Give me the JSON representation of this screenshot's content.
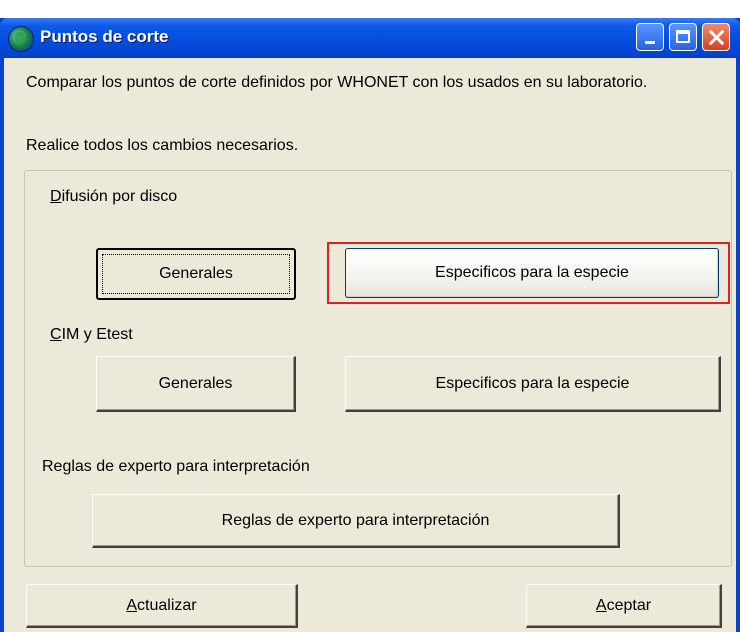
{
  "window": {
    "title": "Puntos de corte"
  },
  "texts": {
    "line1": "Comparar los puntos de corte definidos por WHONET con los usados en su laboratorio.",
    "line2": "Realice todos los cambios necesarios."
  },
  "disk": {
    "label_first": "D",
    "label_rest": "ifusión por disco",
    "general_button": "Generales",
    "species_button": "Especificos para la especie"
  },
  "mic": {
    "label_first": "C",
    "label_rest": "IM y Etest",
    "general_button": "Generales",
    "species_button": "Especificos para la especie"
  },
  "expert": {
    "label": "Reglas de experto para interpretación",
    "button": "Reglas de experto para interpretación"
  },
  "footer": {
    "update_first": "A",
    "update_rest": "ctualizar",
    "accept_first": "A",
    "accept_rest": "ceptar"
  },
  "colors": {
    "titlebar": "#0548d8",
    "client_bg": "#ece9d8",
    "highlight": "#e02020"
  }
}
